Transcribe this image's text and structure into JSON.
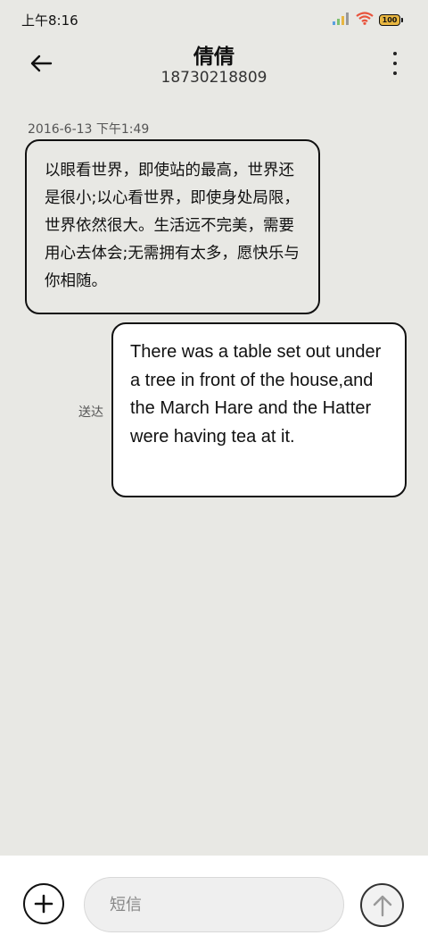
{
  "status_bar": {
    "time": "上午8:16",
    "battery_level": "100",
    "icons": [
      "signal-icon",
      "wifi-icon",
      "battery-icon"
    ]
  },
  "header": {
    "contact_name": "倩倩",
    "contact_number": "18730218809",
    "icons": [
      "back-arrow-icon",
      "more-vertical-icon"
    ]
  },
  "conversation": {
    "timestamp": "2016-6-13 下午1:49",
    "messages": [
      {
        "direction": "incoming",
        "text": "以眼看世界，即使站的最高，世界还是很小;以心看世界，即使身处局限，世界依然很大。生活远不完美，需要用心去体会;无需拥有太多，愿快乐与你相随。"
      },
      {
        "direction": "outgoing",
        "text": "There was a table set out under a tree in front of the house,and the March Hare and the Hatter were having tea at it.",
        "status": "送达"
      }
    ]
  },
  "composer": {
    "placeholder": "短信",
    "value": "",
    "icons": [
      "add-icon",
      "send-arrow-icon"
    ]
  },
  "colors": {
    "background": "#e8e8e4",
    "outgoing_bubble": "#ffffff",
    "bubble_border": "#111111",
    "wifi": "#e8533c",
    "battery_fill": "#e8b640"
  }
}
